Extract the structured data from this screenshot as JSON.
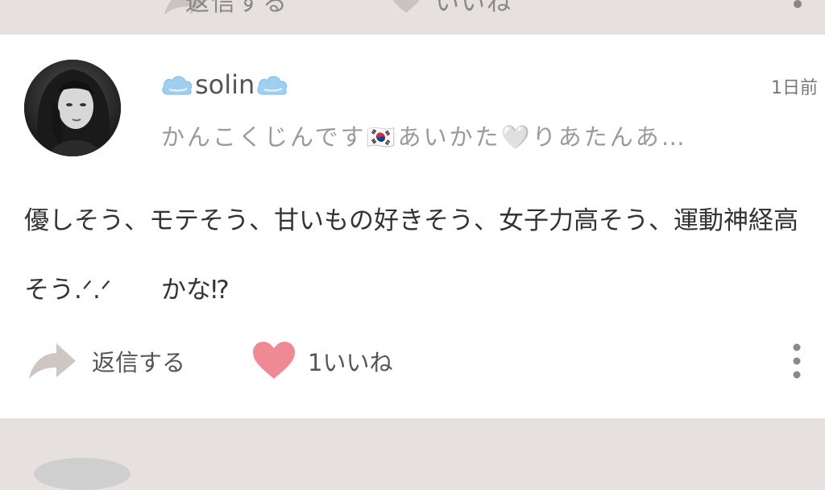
{
  "top_card": {
    "reply_label": "返信する",
    "like_label": "いいね"
  },
  "comment": {
    "username": "solin",
    "timestamp": "1日前",
    "bio": "かんこくじんです🇰🇷あいかた🤍りあたんあ…",
    "text_line1": "優しそう、モテそう、甘いもの好きそう、女子力高そう、運動神経高",
    "text_line2": "そう.ᐟ.ᐟ　　かな⁉︎",
    "reply_label": "返信する",
    "like_label": "1いいね",
    "like_count": 1
  },
  "colors": {
    "background": "#e6e1df",
    "card": "#ffffff",
    "heart": "#ef8a94",
    "cloud": "#8ec9ef"
  },
  "icons": [
    "reply-arrow-icon",
    "heart-icon",
    "more-vertical-icon",
    "cloud-icon"
  ]
}
